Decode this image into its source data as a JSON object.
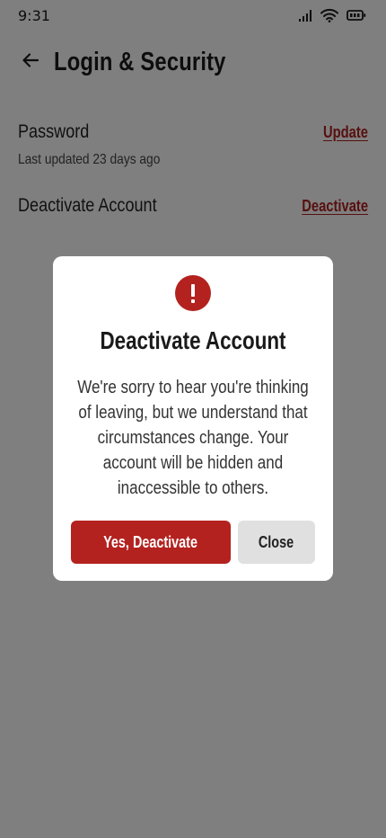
{
  "status_bar": {
    "time": "9:31",
    "icons": [
      "signal-icon",
      "wifi-icon",
      "battery-icon"
    ]
  },
  "header": {
    "back_icon": "arrow-left-icon",
    "title": "Login & Security"
  },
  "settings": {
    "password": {
      "label": "Password",
      "sub": "Last updated 23 days ago",
      "action": "Update"
    },
    "deactivate": {
      "label": "Deactivate Account",
      "action": "Deactivate"
    }
  },
  "dialog": {
    "icon": "exclamation-alert-icon",
    "title": "Deactivate Account",
    "body_lines": [
      "We're sorry to hear you're thinking",
      "of leaving, but we understand that",
      "circumstances change. Your",
      "account will be hidden and",
      "inaccessible to others."
    ],
    "confirm_label": "Yes, Deactivate",
    "close_label": "Close"
  },
  "colors": {
    "accent": "#b3221f",
    "overlay": "rgba(0,0,0,0.5)",
    "secondary_button": "#e0e0e0"
  }
}
